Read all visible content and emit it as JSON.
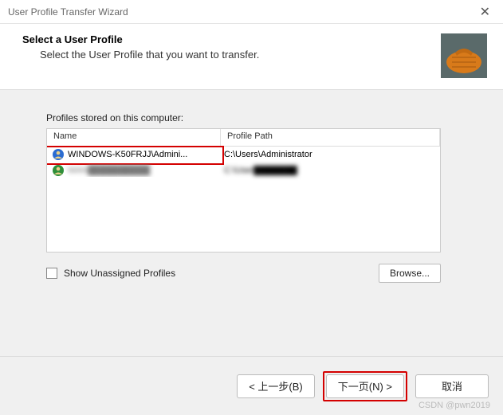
{
  "window": {
    "title": "User Profile Transfer Wizard"
  },
  "header": {
    "title": "Select a User Profile",
    "subtitle": "Select the User Profile that you want to transfer."
  },
  "content": {
    "list_label": "Profiles stored on this computer:",
    "columns": {
      "name": "Name",
      "path": "Profile Path"
    },
    "rows": [
      {
        "name": "WINDOWS-K50FRJJ\\Admini...",
        "path": "C:\\Users\\Administrator"
      },
      {
        "name": "WAN██████████",
        "path": "C:\\User███████"
      }
    ],
    "show_unassigned": "Show Unassigned Profiles",
    "browse": "Browse..."
  },
  "footer": {
    "back": "< 上一步(B)",
    "next": "下一页(N) >",
    "cancel": "取消"
  },
  "watermark": "CSDN @pwn2019"
}
